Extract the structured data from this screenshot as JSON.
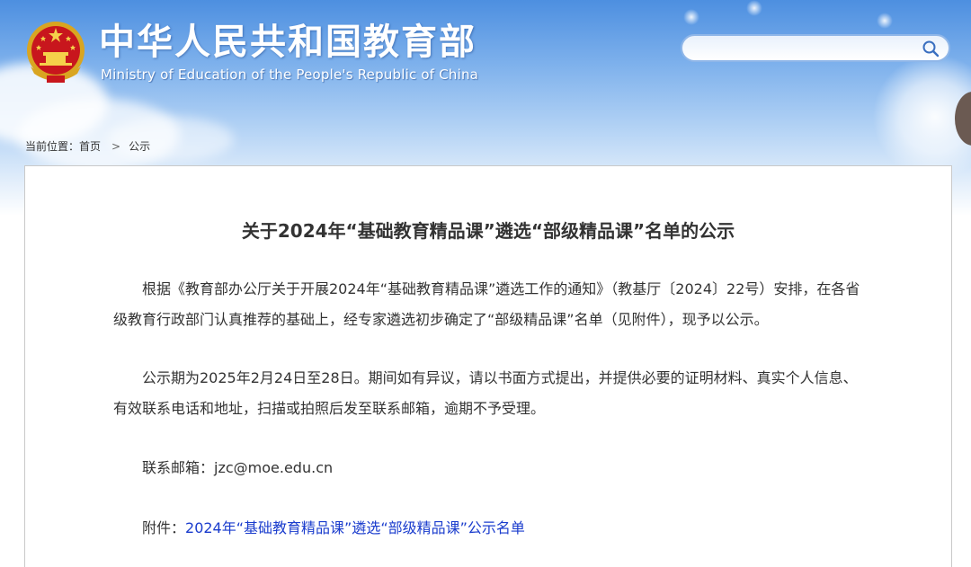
{
  "header": {
    "title": "中华人民共和国教育部",
    "subtitle": "Ministry of Education of the People's Republic of China"
  },
  "search": {
    "placeholder": ""
  },
  "breadcrumb": {
    "label": "当前位置：",
    "home": "首页",
    "separator": ">",
    "current": "公示"
  },
  "article": {
    "title": "关于2024年“基础教育精品课”遴选“部级精品课”名单的公示",
    "paragraph1": "根据《教育部办公厅关于开展2024年“基础教育精品课”遴选工作的通知》（教基厅〔2024〕22号）安排，在各省级教育行政部门认真推荐的基础上，经专家遴选初步确定了“部级精品课”名单（见附件），现予以公示。",
    "paragraph2": "公示期为2025年2月24日至28日。期间如有异议，请以书面方式提出，并提供必要的证明材料、真实个人信息、有效联系电话和地址，扫描或拍照后发至联系邮箱，逾期不予受理。",
    "contact_label": "联系邮箱：",
    "contact_email": "jzc@moe.edu.cn",
    "attachment_label": "附件：",
    "attachment_link": "2024年“基础教育精品课”遴选“部级精品课”公示名单"
  },
  "icons": {
    "emblem": "national-emblem-icon",
    "search": "search-icon"
  },
  "colors": {
    "link": "#1a3ccd",
    "header_blue": "#4d8fe0"
  }
}
